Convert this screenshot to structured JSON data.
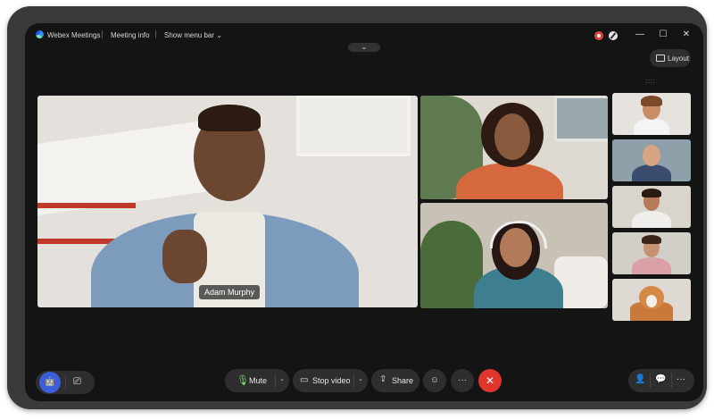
{
  "titlebar": {
    "app_name": "Webex Meetings",
    "meeting_info": "Meeting info",
    "show_menu_bar": "Show menu bar",
    "minimize": "—",
    "maximize": "☐",
    "close": "✕"
  },
  "layout_button": {
    "label": "Layout"
  },
  "collapse_handle": "⌄",
  "grip": "::::",
  "main_video": {
    "name": "Adam Murphy"
  },
  "controls": {
    "mute_label": "Mute",
    "stop_video_label": "Stop video",
    "share_label": "Share",
    "more": "···",
    "end_call": "✕",
    "chevron": "⌄"
  },
  "colors": {
    "accent_green": "#7ddc6f",
    "end_call_red": "#e0362c",
    "recording_red": "#e0453a"
  }
}
